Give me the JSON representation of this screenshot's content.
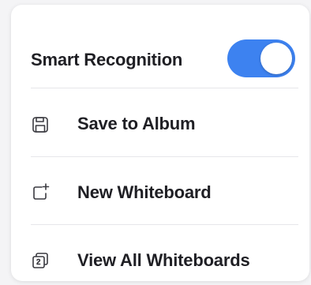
{
  "menu": {
    "toggle": {
      "label": "Smart Recognition",
      "state": "on",
      "accent_color": "#3d82f0"
    },
    "items": [
      {
        "label": "Save to Album",
        "icon": "floppy-disk-icon"
      },
      {
        "label": "New Whiteboard",
        "icon": "new-whiteboard-icon"
      },
      {
        "label": "View All Whiteboards",
        "icon": "whiteboards-stack-icon"
      }
    ]
  }
}
